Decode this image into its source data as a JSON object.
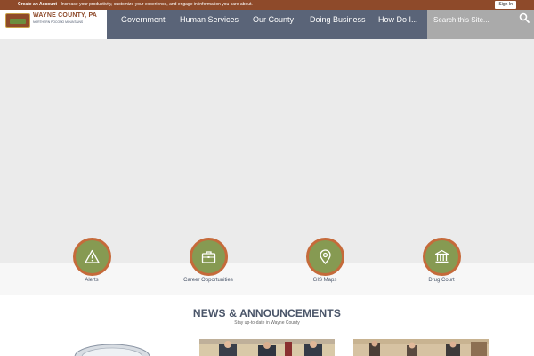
{
  "account_bar": {
    "cta": "Create an Account",
    "message": " - Increase your productivity, customize your experience, and engage in information you care about.",
    "signin_label": "Sign In"
  },
  "logo": {
    "title": "WAYNE COUNTY, PA",
    "subtitle": "NORTHERN POCONO MOUNTAINS"
  },
  "nav": {
    "items": [
      {
        "label": "Government"
      },
      {
        "label": "Human Services"
      },
      {
        "label": "Our County"
      },
      {
        "label": "Doing Business"
      },
      {
        "label": "How Do I..."
      }
    ]
  },
  "search": {
    "placeholder": "Search this Site...",
    "icon": "search-icon"
  },
  "quick_links": [
    {
      "label": "Alerts",
      "icon": "warning-icon"
    },
    {
      "label": "Career Opportunities",
      "icon": "briefcase-icon"
    },
    {
      "label": "GIS Maps",
      "icon": "map-pin-icon"
    },
    {
      "label": "Drug Court",
      "icon": "courthouse-icon"
    }
  ],
  "news": {
    "title": "NEWS & ANNOUNCEMENTS",
    "subtitle": "Stay up-to-date in Wayne County"
  },
  "colors": {
    "brand_brown": "#8e4a2a",
    "nav_slate": "#5a6478",
    "search_gray": "#aaaaaa",
    "icon_green": "#869a52",
    "icon_ring": "#c56a3a"
  }
}
